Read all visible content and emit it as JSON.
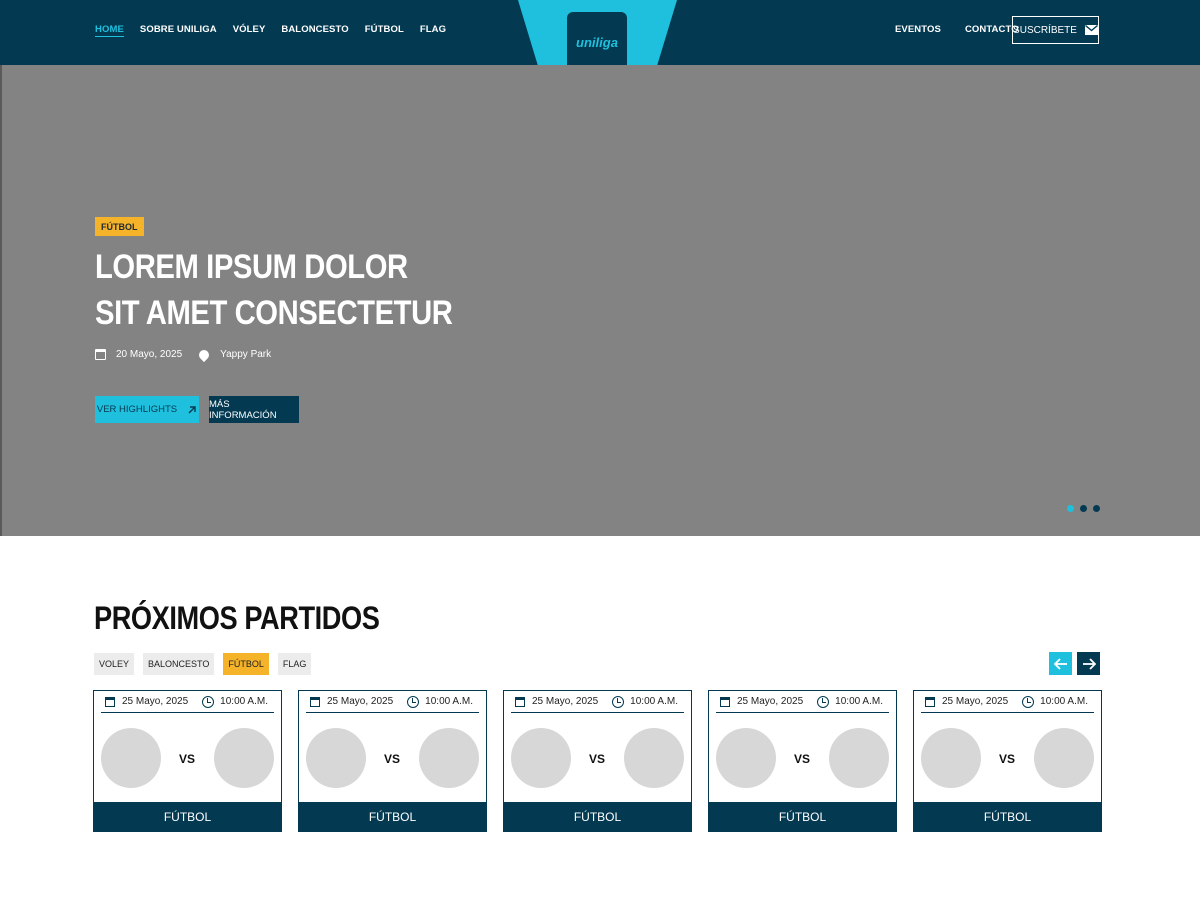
{
  "header": {
    "nav_left": [
      {
        "label": "HOME",
        "active": true
      },
      {
        "label": "SOBRE UNILIGA"
      },
      {
        "label": "VÓLEY"
      },
      {
        "label": "BALONCESTO"
      },
      {
        "label": "FÚTBOL"
      },
      {
        "label": "FLAG"
      }
    ],
    "nav_right": [
      {
        "label": "EVENTOS"
      },
      {
        "label": "CONTACTO"
      }
    ],
    "subscribe_label": "SUSCRÍBETE",
    "logo_text": "uniliga"
  },
  "hero": {
    "badge": "FÚTBOL",
    "title_line1": "LOREM IPSUM DOLOR",
    "title_line2": "SIT AMET CONSECTETUR",
    "date": "20 Mayo, 2025",
    "location": "Yappy Park",
    "btn_highlights": "VER HIGHLIGHTS",
    "btn_info": "MÁS INFORMACIÓN",
    "slides_total": 3,
    "slide_active": 1
  },
  "matches": {
    "title": "PRÓXIMOS PARTIDOS",
    "filters": [
      {
        "label": "VOLEY"
      },
      {
        "label": "BALONCESTO"
      },
      {
        "label": "FÚTBOL",
        "active": true
      },
      {
        "label": "FLAG"
      }
    ],
    "cards": [
      {
        "date": "25 Mayo, 2025",
        "time": "10:00 A.M.",
        "vs": "VS",
        "sport": "FÚTBOL"
      },
      {
        "date": "25 Mayo, 2025",
        "time": "10:00 A.M.",
        "vs": "VS",
        "sport": "FÚTBOL"
      },
      {
        "date": "25 Mayo, 2025",
        "time": "10:00 A.M.",
        "vs": "VS",
        "sport": "FÚTBOL"
      },
      {
        "date": "25 Mayo, 2025",
        "time": "10:00 A.M.",
        "vs": "VS",
        "sport": "FÚTBOL"
      },
      {
        "date": "25 Mayo, 2025",
        "time": "10:00 A.M.",
        "vs": "VS",
        "sport": "FÚTBOL"
      }
    ]
  },
  "colors": {
    "navy": "#033a52",
    "cyan": "#1fc0de",
    "yellow": "#f5b32a",
    "hero_bg": "#838383"
  },
  "icons": {
    "mail": "mail-icon",
    "calendar": "calendar-icon",
    "location": "location-pin-icon",
    "external": "arrow-up-right-icon",
    "clock": "clock-icon",
    "prev": "arrow-left-icon",
    "next": "arrow-right-icon"
  }
}
